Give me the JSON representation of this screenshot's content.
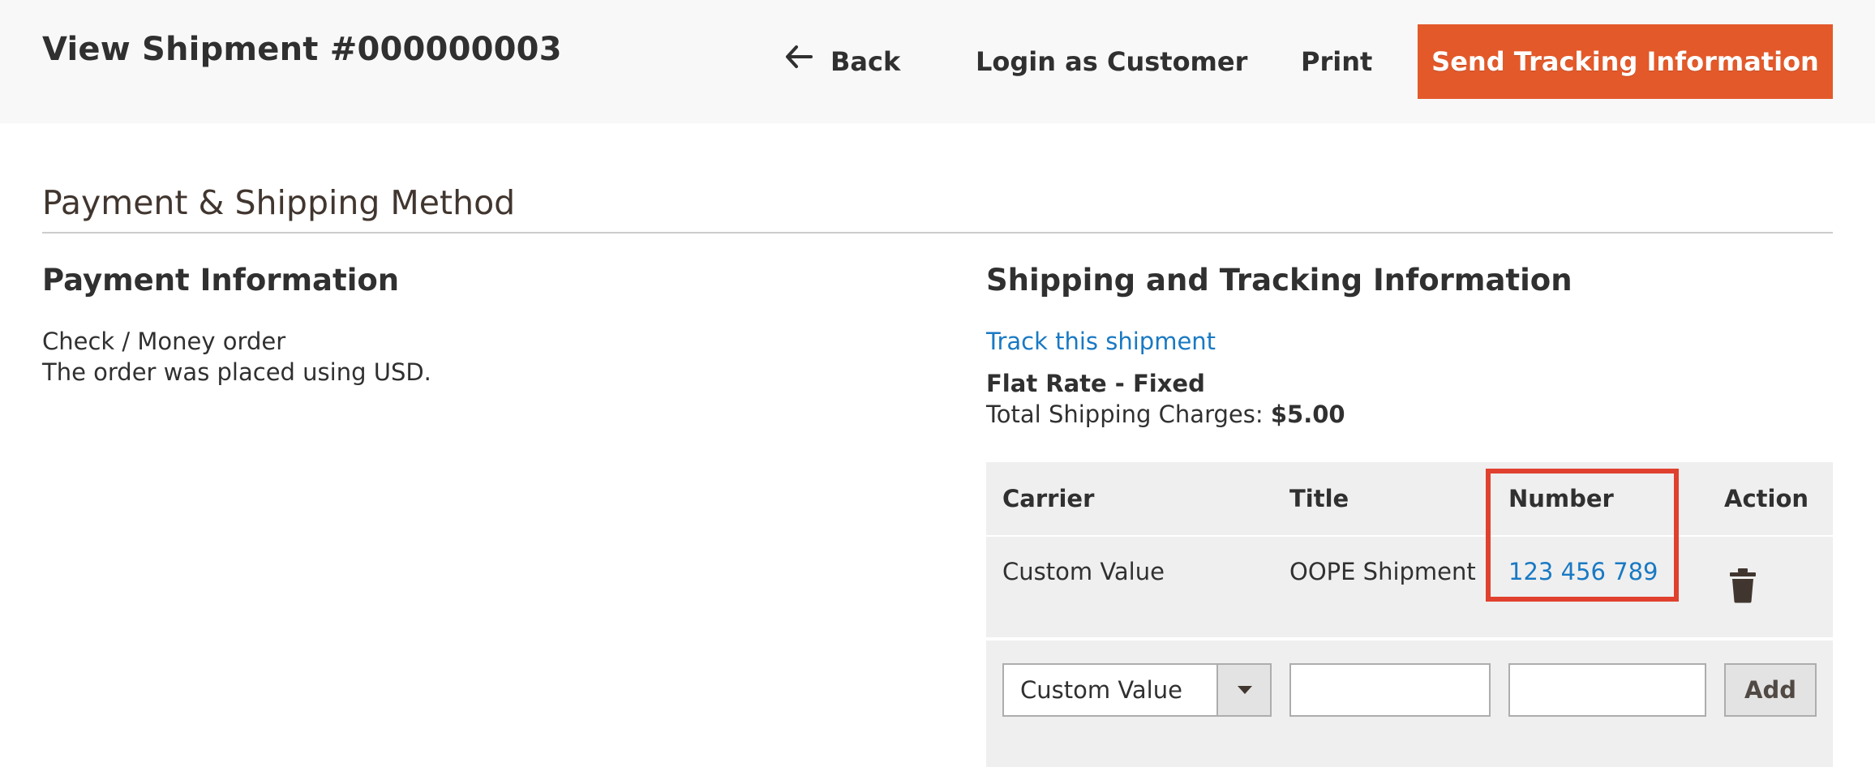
{
  "header": {
    "title": "View Shipment #000000003",
    "back_label": "Back",
    "login_label": "Login as Customer",
    "print_label": "Print",
    "send_label": "Send Tracking Information"
  },
  "section": {
    "title": "Payment & Shipping Method"
  },
  "payment": {
    "title": "Payment Information",
    "method": "Check / Money order",
    "currency_note": "The order was placed using USD."
  },
  "shipping": {
    "title": "Shipping and Tracking Information",
    "track_link": "Track this shipment",
    "method": "Flat Rate - Fixed",
    "charges_label": "Total Shipping Charges:",
    "charges_value": "$5.00"
  },
  "tracking_table": {
    "headers": {
      "carrier": "Carrier",
      "title": "Title",
      "number": "Number",
      "action": "Action"
    },
    "rows": [
      {
        "carrier": "Custom Value",
        "title": "OOPE Shipment",
        "number": "123 456 789"
      }
    ],
    "new_row": {
      "carrier_selected": "Custom Value",
      "title_value": "",
      "number_value": "",
      "add_label": "Add"
    }
  },
  "colors": {
    "primary_button": "#e3592a",
    "link": "#1979c3",
    "highlight": "#e0412e"
  }
}
